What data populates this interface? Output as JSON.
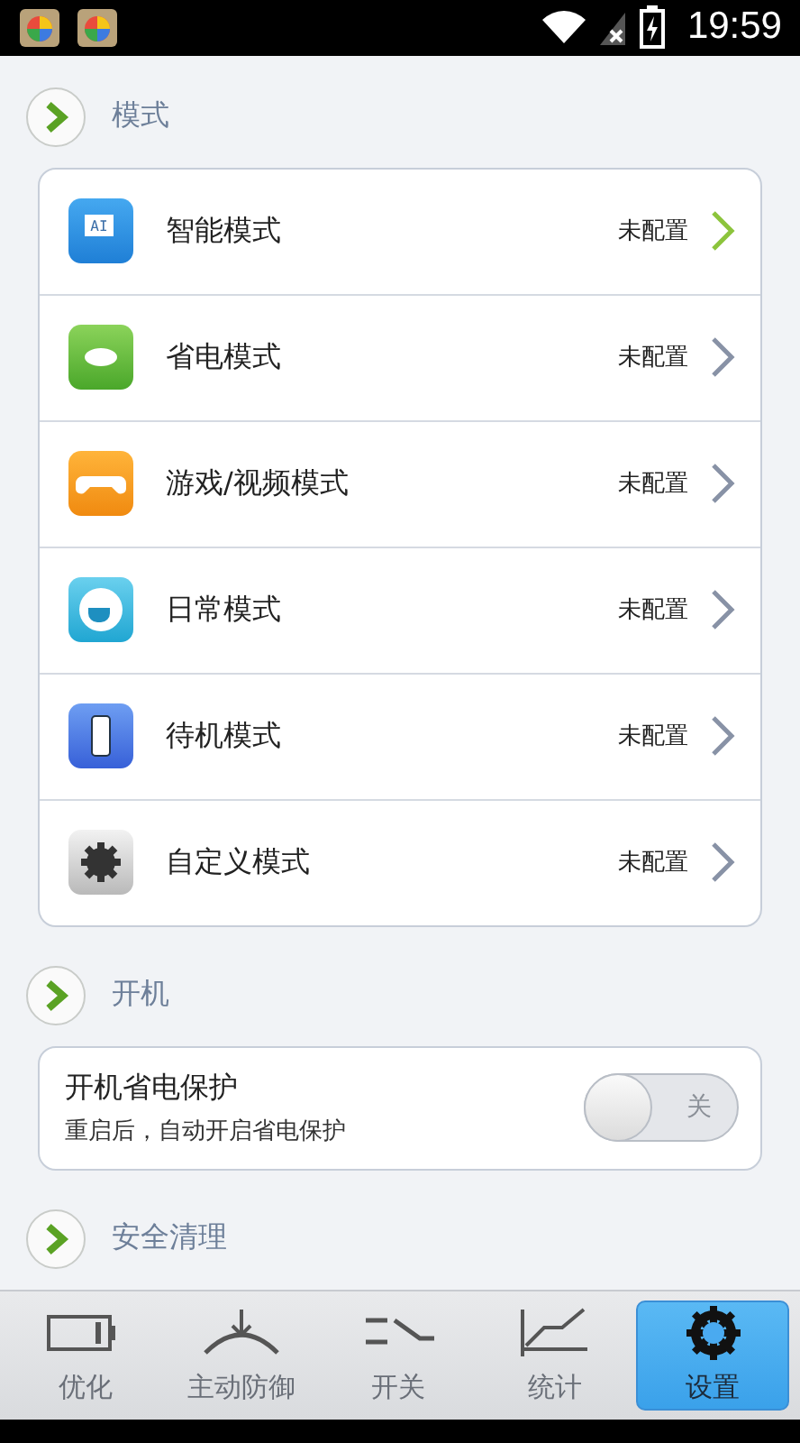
{
  "status_bar": {
    "time": "19:59",
    "notifications": [
      {
        "kind": "app"
      },
      {
        "kind": "app"
      }
    ],
    "charging": true
  },
  "sections": [
    {
      "title": "模式",
      "kind": "modes",
      "items": [
        {
          "label": "智能模式",
          "status": "未配置",
          "kind": "ai",
          "icon_text": "AI",
          "selected": true
        },
        {
          "label": "省电模式",
          "status": "未配置",
          "kind": "leaf",
          "selected": false
        },
        {
          "label": "游戏/视频模式",
          "status": "未配置",
          "kind": "game",
          "selected": false
        },
        {
          "label": "日常模式",
          "status": "未配置",
          "kind": "cup",
          "selected": false
        },
        {
          "label": "待机模式",
          "status": "未配置",
          "kind": "phone",
          "selected": false
        },
        {
          "label": "自定义模式",
          "status": "未配置",
          "kind": "gear",
          "selected": false
        }
      ]
    },
    {
      "title": "开机",
      "kind": "toggles",
      "items": [
        {
          "label": "开机省电保护",
          "description": "重启后，自动开启省电保护",
          "on": false,
          "toggle_label": "关"
        }
      ]
    },
    {
      "title": "安全清理"
    }
  ],
  "tabs": [
    {
      "label": "优化",
      "kind": "battery",
      "selected": false
    },
    {
      "label": "主动防御",
      "kind": "shield",
      "selected": false
    },
    {
      "label": "开关",
      "kind": "switch",
      "selected": false
    },
    {
      "label": "统计",
      "kind": "chart",
      "selected": false
    },
    {
      "label": "设置",
      "kind": "gear",
      "selected": true
    }
  ]
}
